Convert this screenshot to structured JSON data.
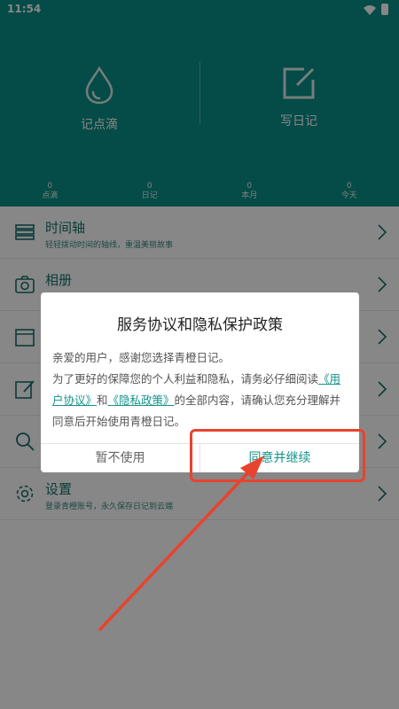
{
  "status_bar": {
    "time": "11:54"
  },
  "header": {
    "actions": [
      {
        "label": "记点滴",
        "icon": "drop-icon"
      },
      {
        "label": "写日记",
        "icon": "edit-icon"
      }
    ],
    "stats": [
      {
        "value": "0",
        "label": "点滴"
      },
      {
        "value": "0",
        "label": "日记"
      },
      {
        "value": "0",
        "label": "本月"
      },
      {
        "value": "0",
        "label": "今天"
      }
    ]
  },
  "menu": {
    "items": [
      {
        "title": "时间轴",
        "subtitle": "轻轻拨动时间的轴线，重温美丽故事",
        "icon": "timeline-icon"
      },
      {
        "title": "相册",
        "subtitle": "",
        "icon": "camera-icon"
      },
      {
        "title": "",
        "subtitle": "",
        "icon": "calendar-icon"
      },
      {
        "title": "",
        "subtitle": "",
        "icon": "notes-icon"
      },
      {
        "title": "",
        "subtitle": "",
        "icon": "search-icon"
      },
      {
        "title": "设置",
        "subtitle": "登录青橙账号，永久保存日记到云端",
        "icon": "gear-icon"
      }
    ]
  },
  "dialog": {
    "title": "服务协议和隐私保护政策",
    "line1": "亲爱的用户，感谢您选择青橙日记。",
    "line2_pre": "为了更好的保障您的个人利益和隐私，请务必仔细阅读",
    "link_terms": "《用户协议》",
    "and": "和",
    "link_privacy": "《隐私政策》",
    "line2_post": "的全部内容，请确认您充分理解并同意后开始使用青橙日记。",
    "decline": "暂不使用",
    "accept": "同意并继续"
  },
  "colors": {
    "brand": "#0b8f86",
    "accent_text": "#13938a",
    "annotation": "#e8432e"
  }
}
